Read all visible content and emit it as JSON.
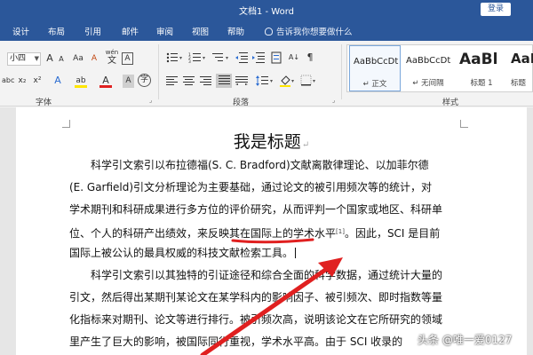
{
  "window": {
    "title": "文档1 - Word",
    "login_label": "登录"
  },
  "tabs": [
    "设计",
    "布局",
    "引用",
    "邮件",
    "审阅",
    "视图",
    "帮助"
  ],
  "tell_me": "告诉我你想要做什么",
  "ribbon": {
    "font_size": "小四",
    "grow_font": "A",
    "shrink_font": "A",
    "change_case": "Aa",
    "clear_format": "A",
    "wen": "wén",
    "wen_char": "文",
    "char_border": "A",
    "strike": "abc",
    "subscript": "x₂",
    "superscript": "x²",
    "text_effect": "A",
    "highlight": "ab",
    "font_color": "A",
    "char_shading": "A",
    "char_circle": "字",
    "group_font": "字体",
    "group_paragraph": "段落",
    "group_styles": "样式",
    "sort": "A↓",
    "styles": [
      {
        "sample": "AaBbCcDt",
        "name": "↵ 正文"
      },
      {
        "sample": "AaBbCcDt",
        "name": "↵ 无间隔"
      },
      {
        "sample": "AaBl",
        "name": "标题 1"
      },
      {
        "sample": "AaBl",
        "name": "标题"
      }
    ]
  },
  "document": {
    "title": "我是标题",
    "para_mark": "↵",
    "lines": [
      "科学引文索引以布拉德福(S. C. Bradford)文献离散律理论、以加菲尔德",
      "(E. Garfield)引文分析理论为主要基础，通过论文的被引用频次等的统计，对",
      "学术期刊和科研成果进行多方位的评价研究，从而评判一个国家或地区、科研单",
      "位、个人的科研产出绩效，来反映其在国际上的学术水平",
      "国际上被公认的最具权威的科技文献检索工具。",
      "科学引文索引以其独特的引证途径和综合全面的科学数据，通过统计大量的",
      "引文，然后得出某期刊某论文在某学科内的影响因子、被引频次、即时指数等量",
      "化指标来对期刊、论文等进行排行。被引频次高，说明该论文在它所研究的领域",
      "里产生了巨大的影响，被国际同行重视，学术水平高。由于 SCI 收录的"
    ],
    "citation": "[1]",
    "line4_tail": "。因此，SCI 是目前"
  },
  "watermark": "头条 @唯一爱0127",
  "colors": {
    "title_bar": "#2b579a",
    "annotation": "#e02020",
    "highlight": "#ffe600",
    "font_red": "#e02020"
  }
}
